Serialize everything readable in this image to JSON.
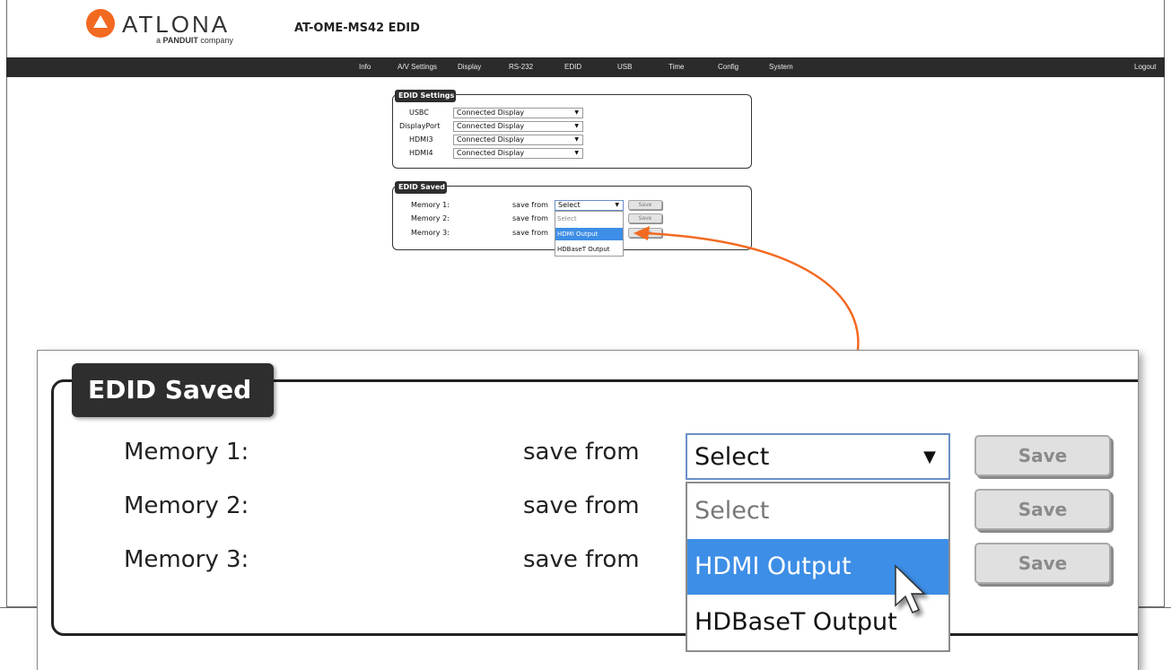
{
  "brand": {
    "logo_text": "ATLONA",
    "logo_sub_prefix": "a",
    "logo_sub_brand": "PANDUIT",
    "logo_sub_suffix": "company",
    "accent": "#f26a21"
  },
  "page_title": "AT-OME-MS42  EDID",
  "nav": {
    "items": [
      "Info",
      "A/V Settings",
      "Display",
      "RS-232",
      "EDID",
      "USB",
      "Time",
      "Config",
      "System"
    ],
    "logout": "Logout"
  },
  "edid_settings": {
    "legend": "EDID Settings",
    "rows": [
      {
        "label": "USBC",
        "value": "Connected Display"
      },
      {
        "label": "DisplayPort",
        "value": "Connected Display"
      },
      {
        "label": "HDMI3",
        "value": "Connected Display"
      },
      {
        "label": "HDMI4",
        "value": "Connected Display"
      }
    ]
  },
  "edid_saved": {
    "legend": "EDID Saved",
    "save_from": "save from",
    "save_label": "Save",
    "rows": [
      {
        "label": "Memory 1:"
      },
      {
        "label": "Memory 2:"
      },
      {
        "label": "Memory 3:"
      }
    ],
    "select_value": "Select",
    "options": [
      "Select",
      "HDMI Output",
      "HDBaseT Output"
    ],
    "highlighted_option": "HDMI Output",
    "highlight_color": "#3d8ee6"
  },
  "icons": {
    "dropdown": "caret-down-icon",
    "cursor": "mouse-pointer-icon",
    "logo": "atlona-logo-icon",
    "callout": "callout-arrow"
  }
}
